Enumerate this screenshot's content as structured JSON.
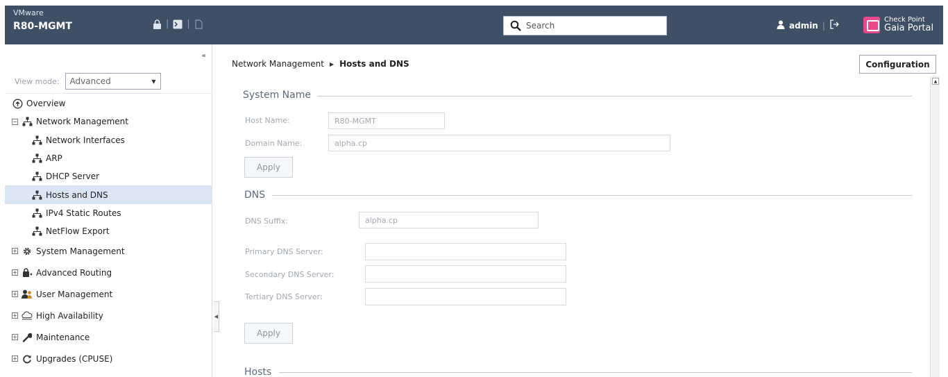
{
  "header": {
    "vendor": "VMware",
    "hostname": "R80-MGMT",
    "search_placeholder": "Search",
    "user": "admin",
    "logo_line1": "Check Point",
    "logo_line2": "Gaia Portal"
  },
  "sidebar": {
    "collapse_glyph": "«",
    "view_mode_label": "View mode:",
    "view_mode_value": "Advanced",
    "items": [
      {
        "label": "Overview"
      },
      {
        "label": "Network Management"
      },
      {
        "label": "Network Interfaces"
      },
      {
        "label": "ARP"
      },
      {
        "label": "DHCP Server"
      },
      {
        "label": "Hosts and DNS"
      },
      {
        "label": "IPv4 Static Routes"
      },
      {
        "label": "NetFlow Export"
      },
      {
        "label": "System Management"
      },
      {
        "label": "Advanced Routing"
      },
      {
        "label": "User Management"
      },
      {
        "label": "High Availability"
      },
      {
        "label": "Maintenance"
      },
      {
        "label": "Upgrades (CPUSE)"
      }
    ]
  },
  "main": {
    "breadcrumb": {
      "parent": "Network Management",
      "current": "Hosts and DNS"
    },
    "configuration_button": "Configuration",
    "system_name": {
      "title": "System Name",
      "host_name_label": "Host Name:",
      "host_name_value": "R80-MGMT",
      "domain_name_label": "Domain Name:",
      "domain_name_value": "alpha.cp",
      "apply_label": "Apply"
    },
    "dns": {
      "title": "DNS",
      "suffix_label": "DNS Suffix:",
      "suffix_value": "alpha.cp",
      "primary_label": "Primary DNS Server:",
      "primary_value": "",
      "secondary_label": "Secondary DNS Server:",
      "secondary_value": "",
      "tertiary_label": "Tertiary DNS Server:",
      "tertiary_value": "",
      "apply_label": "Apply"
    },
    "hosts": {
      "title": "Hosts"
    }
  }
}
